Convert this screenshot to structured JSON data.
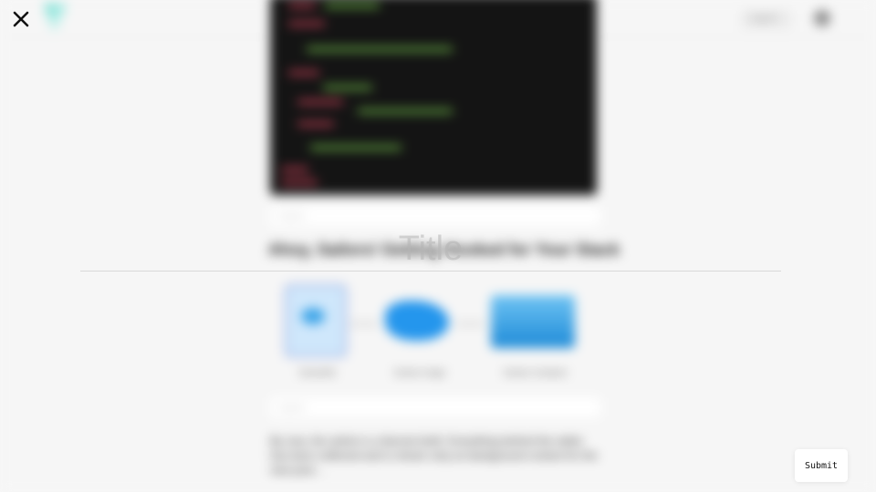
{
  "editor": {
    "title_placeholder": "Title",
    "submit_label": "Submit",
    "close_icon": "close-icon"
  },
  "background_article": {
    "logo_icon": "app-logo",
    "nav_login_label": "Log in",
    "caption_placeholder_1": "Caption",
    "heading": "Ahoy, Sailors! Getting Hooked for Your Stack",
    "diagram_labels": [
      "Dockerfile",
      "Docker Image",
      "Docker Container"
    ],
    "caption_placeholder_2": "Caption",
    "paragraph": "By now, the article is a blurred draft. Everything behind the editor has been softened and is shown only as background context for the new post…"
  },
  "colors": {
    "code_bg": "#141414",
    "docker_blue": "#2496ed",
    "rule": "#d8d8d8"
  }
}
